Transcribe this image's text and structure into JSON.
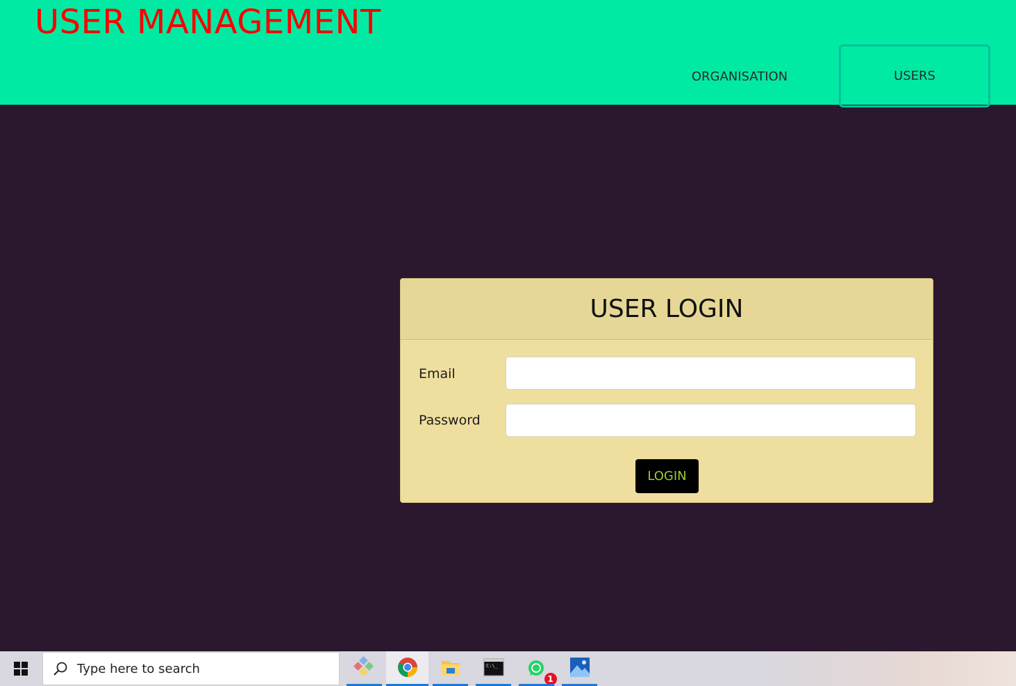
{
  "header": {
    "title": "USER MANAGEMENT",
    "nav": [
      {
        "label": "ORGANISATION"
      },
      {
        "label": "USERS"
      }
    ]
  },
  "login": {
    "title": "USER LOGIN",
    "email_label": "Email",
    "email_value": "",
    "password_label": "Password",
    "password_value": "",
    "button_label": "LOGIN"
  },
  "taskbar": {
    "search_placeholder": "Type here to search",
    "apps": [
      {
        "icon": "pinned-app-icon"
      },
      {
        "icon": "chrome-icon"
      },
      {
        "icon": "file-explorer-icon"
      },
      {
        "icon": "terminal-icon"
      },
      {
        "icon": "whatsapp-icon",
        "badge": "1"
      },
      {
        "icon": "photos-icon"
      }
    ]
  },
  "colors": {
    "header_bg": "#00eaa3",
    "title": "#ff0000",
    "page_bg": "#2b172e",
    "card_bg": "#efdf9f",
    "button_bg": "#000000",
    "button_text": "#9acd32"
  }
}
